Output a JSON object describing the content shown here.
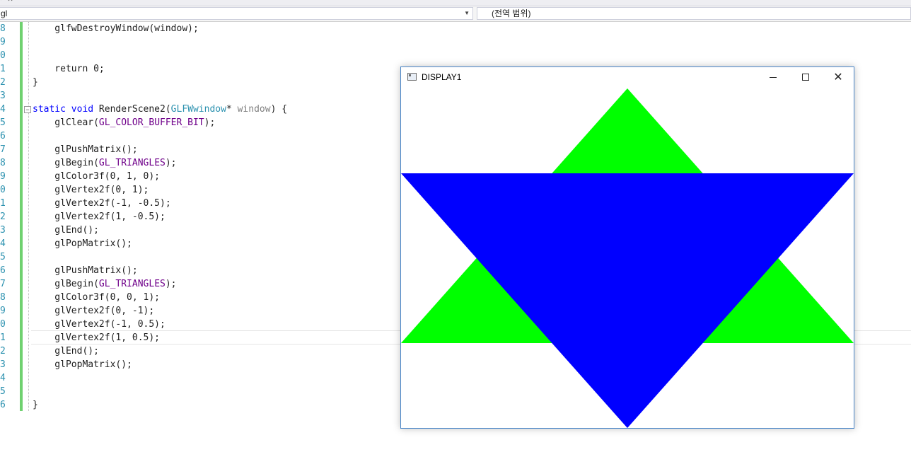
{
  "top_strip": {
    "icons": "▪ ✕"
  },
  "nav": {
    "scope_combo": "gl",
    "member_combo": "(전역 범위)"
  },
  "editor": {
    "line_numbers": [
      "8",
      "9",
      "0",
      "1",
      "2",
      "3",
      "4",
      "5",
      "6",
      "7",
      "8",
      "9",
      "0",
      "1",
      "2",
      "3",
      "4",
      "5",
      "6",
      "7",
      "8",
      "9",
      "0",
      "1",
      "2",
      "3",
      "4",
      "5",
      "6"
    ],
    "lines": [
      [
        {
          "t": "    glfwDestroyWindow(window);"
        }
      ],
      [
        {
          "t": ""
        }
      ],
      [
        {
          "t": ""
        }
      ],
      [
        {
          "t": "    return 0;"
        }
      ],
      [
        {
          "t": "}"
        }
      ],
      [
        {
          "t": ""
        }
      ],
      [
        {
          "t": "static void",
          "c": "kw"
        },
        {
          "t": " RenderScene2("
        },
        {
          "t": "GLFWwindow",
          "c": "ty"
        },
        {
          "t": "* "
        },
        {
          "t": "window",
          "c": "pm"
        },
        {
          "t": ") {"
        }
      ],
      [
        {
          "t": "    glClear("
        },
        {
          "t": "GL_COLOR_BUFFER_BIT",
          "c": "mc"
        },
        {
          "t": ");"
        }
      ],
      [
        {
          "t": ""
        }
      ],
      [
        {
          "t": "    glPushMatrix();"
        }
      ],
      [
        {
          "t": "    glBegin("
        },
        {
          "t": "GL_TRIANGLES",
          "c": "mc"
        },
        {
          "t": ");"
        }
      ],
      [
        {
          "t": "    glColor3f(0, 1, 0);"
        }
      ],
      [
        {
          "t": "    glVertex2f(0, 1);"
        }
      ],
      [
        {
          "t": "    glVertex2f(-1, -0.5);"
        }
      ],
      [
        {
          "t": "    glVertex2f(1, -0.5);"
        }
      ],
      [
        {
          "t": "    glEnd();"
        }
      ],
      [
        {
          "t": "    glPopMatrix();"
        }
      ],
      [
        {
          "t": ""
        }
      ],
      [
        {
          "t": "    glPushMatrix();"
        }
      ],
      [
        {
          "t": "    glBegin("
        },
        {
          "t": "GL_TRIANGLES",
          "c": "mc"
        },
        {
          "t": ");"
        }
      ],
      [
        {
          "t": "    glColor3f(0, 0, 1);"
        }
      ],
      [
        {
          "t": "    glVertex2f(0, -1);"
        }
      ],
      [
        {
          "t": "    glVertex2f(-1, 0.5);"
        }
      ],
      [
        {
          "t": "    glVertex2f(1, 0.5);"
        }
      ],
      [
        {
          "t": "    glEnd();"
        }
      ],
      [
        {
          "t": "    glPopMatrix();"
        }
      ],
      [
        {
          "t": ""
        }
      ],
      [
        {
          "t": ""
        }
      ],
      [
        {
          "t": "}"
        }
      ]
    ]
  },
  "gl_window": {
    "title": "DISPLAY1",
    "controls": {
      "minimize": "minimize-icon",
      "maximize": "maximize-icon",
      "close": "✕"
    },
    "triangles": [
      {
        "color": "#00ff00",
        "vertices": [
          [
            0,
            1
          ],
          [
            -1,
            -0.5
          ],
          [
            1,
            -0.5
          ]
        ]
      },
      {
        "color": "#0000ff",
        "vertices": [
          [
            0,
            -1
          ],
          [
            -1,
            0.5
          ],
          [
            1,
            0.5
          ]
        ]
      }
    ]
  }
}
